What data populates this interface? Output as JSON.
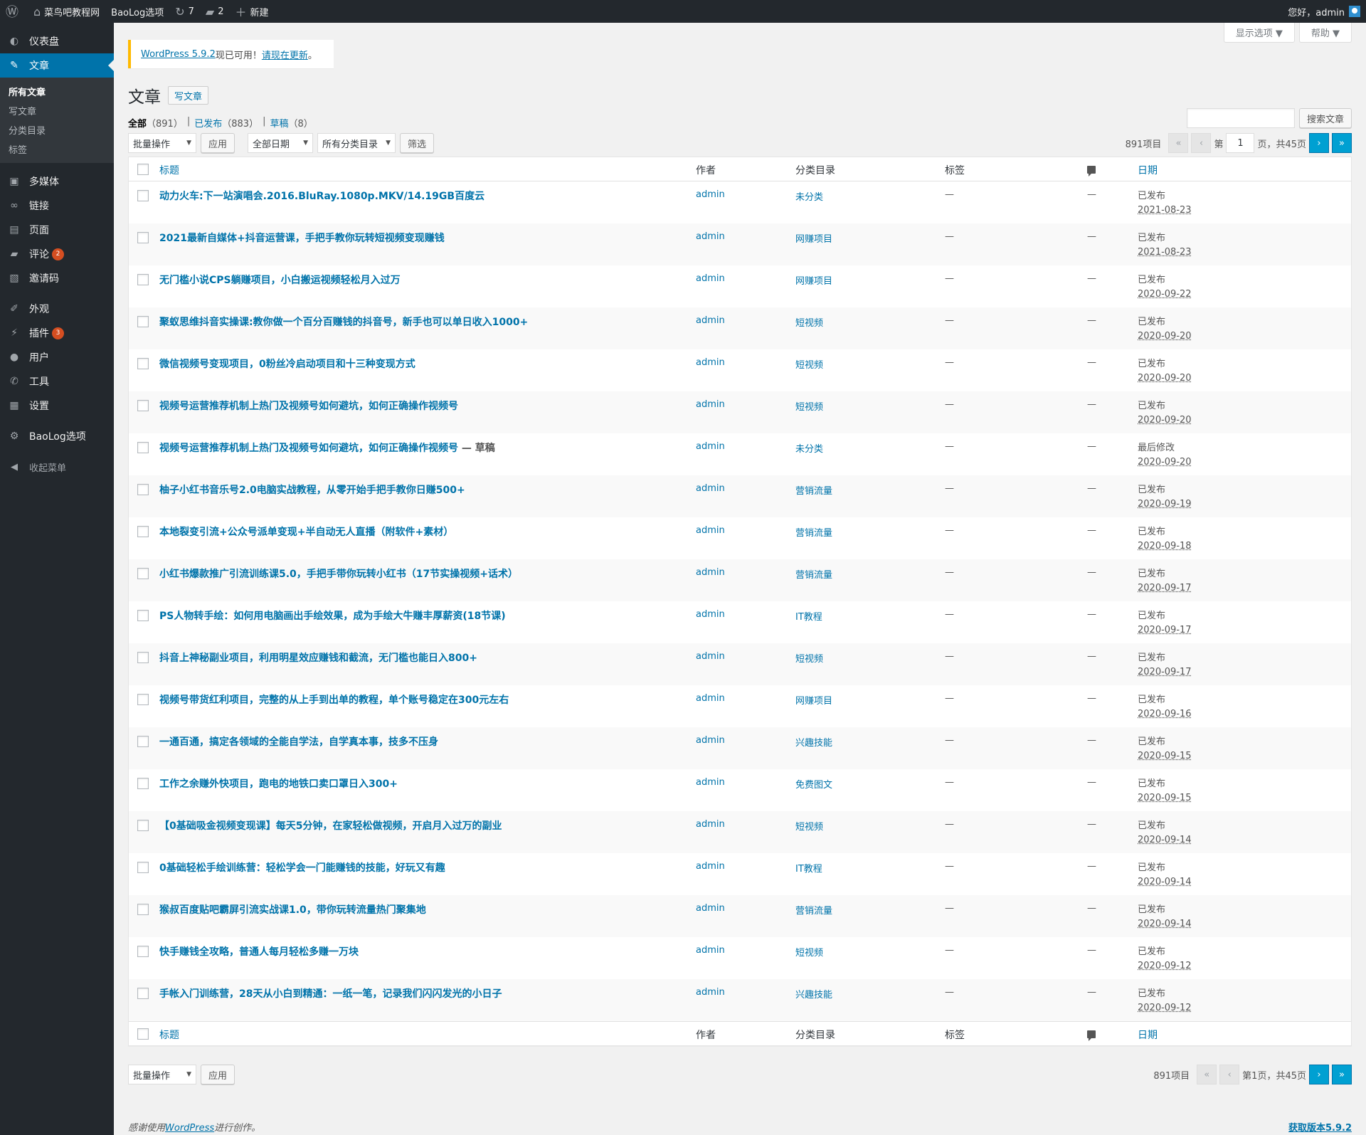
{
  "adminbar": {
    "site_name": "菜鸟吧教程网",
    "options": "BaoLog选项",
    "updates_count": "7",
    "comments_count": "2",
    "new_label": "新建",
    "greeting": "您好，admin"
  },
  "sidebar": {
    "items": [
      {
        "label": "仪表盘",
        "icon": "dashboard-icon",
        "glyph": "◐"
      },
      {
        "label": "文章",
        "icon": "pin-icon",
        "glyph": "✎",
        "current": true
      },
      {
        "label": "多媒体",
        "icon": "media-icon",
        "glyph": "▣"
      },
      {
        "label": "链接",
        "icon": "link-icon",
        "glyph": "∞"
      },
      {
        "label": "页面",
        "icon": "page-icon",
        "glyph": "▤"
      },
      {
        "label": "评论",
        "icon": "comment-icon",
        "glyph": "▰",
        "badge": "2"
      },
      {
        "label": "邀请码",
        "icon": "invite-icon",
        "glyph": "▧"
      },
      {
        "label": "外观",
        "icon": "appearance-icon",
        "glyph": "✐"
      },
      {
        "label": "插件",
        "icon": "plugin-icon",
        "glyph": "⚡",
        "badge": "3"
      },
      {
        "label": "用户",
        "icon": "user-icon",
        "glyph": "●"
      },
      {
        "label": "工具",
        "icon": "tool-icon",
        "glyph": "✆"
      },
      {
        "label": "设置",
        "icon": "settings-icon",
        "glyph": "▦"
      },
      {
        "label": "BaoLog选项",
        "icon": "gear-icon",
        "glyph": "⚙"
      }
    ],
    "submenu": [
      "所有文章",
      "写文章",
      "分类目录",
      "标签"
    ],
    "collapse": "收起菜单"
  },
  "screen_meta": {
    "screen_options": "显示选项 ▼",
    "help": "帮助 ▼"
  },
  "notice": {
    "link1": "WordPress 5.9.2",
    "text": "现已可用！",
    "link2": "请现在更新",
    "end": "。"
  },
  "page": {
    "title": "文章",
    "add_new": "写文章"
  },
  "views": {
    "all": "全部",
    "all_count": "（891）",
    "published": "已发布",
    "published_count": "（883）",
    "drafts": "草稿",
    "drafts_count": "（8）"
  },
  "search": {
    "button": "搜索文章"
  },
  "tablenav_top": {
    "bulk": "批量操作",
    "apply": "应用",
    "dates": "全部日期",
    "cats": "所有分类目录",
    "filter": "筛选",
    "items": "891项目",
    "page_prefix": "第",
    "current_page": "1",
    "page_suffix": "页，共45页",
    "first": "«",
    "prev": "‹",
    "next": "›",
    "last": "»"
  },
  "tablenav_bottom": {
    "bulk": "批量操作",
    "apply": "应用",
    "items": "891项目",
    "page_text": "第1页，共45页",
    "first": "«",
    "prev": "‹",
    "next": "›",
    "last": "»"
  },
  "columns": {
    "title": "标题",
    "author": "作者",
    "categories": "分类目录",
    "tags": "标签",
    "date": "日期"
  },
  "posts": [
    {
      "title": "动力火车:下一站演唱会.2016.BluRay.1080p.MKV/14.19GB百度云",
      "state": "",
      "author": "admin",
      "category": "未分类",
      "tags": "—",
      "comments": "—",
      "status": "已发布",
      "date": "2021-08-23"
    },
    {
      "title": "2021最新自媒体+抖音运营课，手把手教你玩转短视频变现赚钱",
      "state": "",
      "author": "admin",
      "category": "网赚项目",
      "tags": "—",
      "comments": "—",
      "status": "已发布",
      "date": "2021-08-23"
    },
    {
      "title": "无门槛小说CPS躺赚项目，小白搬运视频轻松月入过万",
      "state": "",
      "author": "admin",
      "category": "网赚项目",
      "tags": "—",
      "comments": "—",
      "status": "已发布",
      "date": "2020-09-22"
    },
    {
      "title": "聚蚁思维抖音实操课:教你做一个百分百赚钱的抖音号，新手也可以单日收入1000+",
      "state": "",
      "author": "admin",
      "category": "短视频",
      "tags": "—",
      "comments": "—",
      "status": "已发布",
      "date": "2020-09-20"
    },
    {
      "title": "微信视频号变现项目，0粉丝冷启动项目和十三种变现方式",
      "state": "",
      "author": "admin",
      "category": "短视频",
      "tags": "—",
      "comments": "—",
      "status": "已发布",
      "date": "2020-09-20"
    },
    {
      "title": "视频号运营推荐机制上热门及视频号如何避坑，如何正确操作视频号",
      "state": "",
      "author": "admin",
      "category": "短视频",
      "tags": "—",
      "comments": "—",
      "status": "已发布",
      "date": "2020-09-20"
    },
    {
      "title": "视频号运营推荐机制上热门及视频号如何避坑，如何正确操作视频号",
      "state": " — 草稿",
      "author": "admin",
      "category": "未分类",
      "tags": "—",
      "comments": "—",
      "status": "最后修改",
      "date": "2020-09-20"
    },
    {
      "title": "柚子小红书音乐号2.0电脑实战教程，从零开始手把手教你日赚500+",
      "state": "",
      "author": "admin",
      "category": "营销流量",
      "tags": "—",
      "comments": "—",
      "status": "已发布",
      "date": "2020-09-19"
    },
    {
      "title": "本地裂变引流+公众号派单变现+半自动无人直播（附软件+素材）",
      "state": "",
      "author": "admin",
      "category": "营销流量",
      "tags": "—",
      "comments": "—",
      "status": "已发布",
      "date": "2020-09-18"
    },
    {
      "title": "小红书爆款推广引流训练课5.0，手把手带你玩转小红书（17节实操视频+话术）",
      "state": "",
      "author": "admin",
      "category": "营销流量",
      "tags": "—",
      "comments": "—",
      "status": "已发布",
      "date": "2020-09-17"
    },
    {
      "title": "PS人物转手绘：如何用电脑画出手绘效果，成为手绘大牛赚丰厚薪资(18节课)",
      "state": "",
      "author": "admin",
      "category": "IT教程",
      "tags": "—",
      "comments": "—",
      "status": "已发布",
      "date": "2020-09-17"
    },
    {
      "title": "抖音上神秘副业项目，利用明星效应赚钱和截流，无门槛也能日入800+",
      "state": "",
      "author": "admin",
      "category": "短视频",
      "tags": "—",
      "comments": "—",
      "status": "已发布",
      "date": "2020-09-17"
    },
    {
      "title": "视频号带货红利项目，完整的从上手到出单的教程，单个账号稳定在300元左右",
      "state": "",
      "author": "admin",
      "category": "网赚项目",
      "tags": "—",
      "comments": "—",
      "status": "已发布",
      "date": "2020-09-16"
    },
    {
      "title": "一通百通，搞定各领域的全能自学法，自学真本事，技多不压身",
      "state": "",
      "author": "admin",
      "category": "兴趣技能",
      "tags": "—",
      "comments": "—",
      "status": "已发布",
      "date": "2020-09-15"
    },
    {
      "title": "工作之余赚外快项目，跑电的地铁口卖口罩日入300+",
      "state": "",
      "author": "admin",
      "category": "免费图文",
      "tags": "—",
      "comments": "—",
      "status": "已发布",
      "date": "2020-09-15"
    },
    {
      "title": "【0基础吸金视频变现课】每天5分钟，在家轻松做视频，开启月入过万的副业",
      "state": "",
      "author": "admin",
      "category": "短视频",
      "tags": "—",
      "comments": "—",
      "status": "已发布",
      "date": "2020-09-14"
    },
    {
      "title": "0基础轻松手绘训练营：轻松学会一门能赚钱的技能，好玩又有趣",
      "state": "",
      "author": "admin",
      "category": "IT教程",
      "tags": "—",
      "comments": "—",
      "status": "已发布",
      "date": "2020-09-14"
    },
    {
      "title": "猴叔百度贴吧霸屏引流实战课1.0，带你玩转流量热门聚集地",
      "state": "",
      "author": "admin",
      "category": "营销流量",
      "tags": "—",
      "comments": "—",
      "status": "已发布",
      "date": "2020-09-14"
    },
    {
      "title": "快手赚钱全攻略，普通人每月轻松多赚一万块",
      "state": "",
      "author": "admin",
      "category": "短视频",
      "tags": "—",
      "comments": "—",
      "status": "已发布",
      "date": "2020-09-12"
    },
    {
      "title": "手帐入门训练营，28天从小白到精通：一纸一笔，记录我们闪闪发光的小日子",
      "state": "",
      "author": "admin",
      "category": "兴趣技能",
      "tags": "—",
      "comments": "—",
      "status": "已发布",
      "date": "2020-09-12"
    }
  ],
  "footer": {
    "thanks_pre": "感谢使用",
    "thanks_link": "WordPress",
    "thanks_post": "进行创作。",
    "version": "获取版本5.9.2"
  }
}
